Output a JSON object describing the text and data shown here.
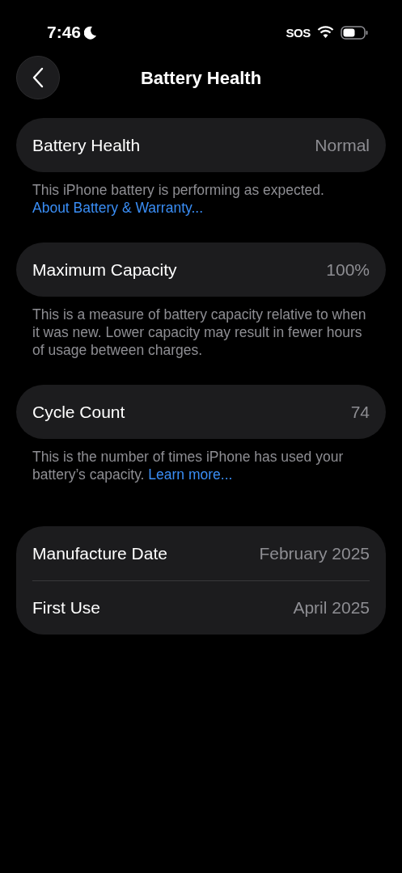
{
  "status_bar": {
    "time": "7:46",
    "sos": "SOS"
  },
  "nav": {
    "title": "Battery Health"
  },
  "sections": [
    {
      "rows": [
        {
          "label": "Battery Health",
          "value": "Normal"
        }
      ],
      "footer": [
        {
          "kind": "text",
          "text": "This iPhone battery is performing as expected. "
        },
        {
          "kind": "link",
          "text": "About Battery & Warranty..."
        }
      ]
    },
    {
      "rows": [
        {
          "label": "Maximum Capacity",
          "value": "100%"
        }
      ],
      "footer": [
        {
          "kind": "text",
          "text": "This is a measure of battery capacity relative to when it was new. Lower capacity may result in fewer hours of usage between charges."
        }
      ]
    },
    {
      "rows": [
        {
          "label": "Cycle Count",
          "value": "74"
        }
      ],
      "footer": [
        {
          "kind": "text",
          "text": "This is the number of times iPhone has used your battery’s capacity. "
        },
        {
          "kind": "link",
          "text": "Learn more..."
        }
      ]
    },
    {
      "rows": [
        {
          "label": "Manufacture Date",
          "value": "February 2025"
        },
        {
          "label": "First Use",
          "value": "April 2025"
        }
      ]
    }
  ]
}
